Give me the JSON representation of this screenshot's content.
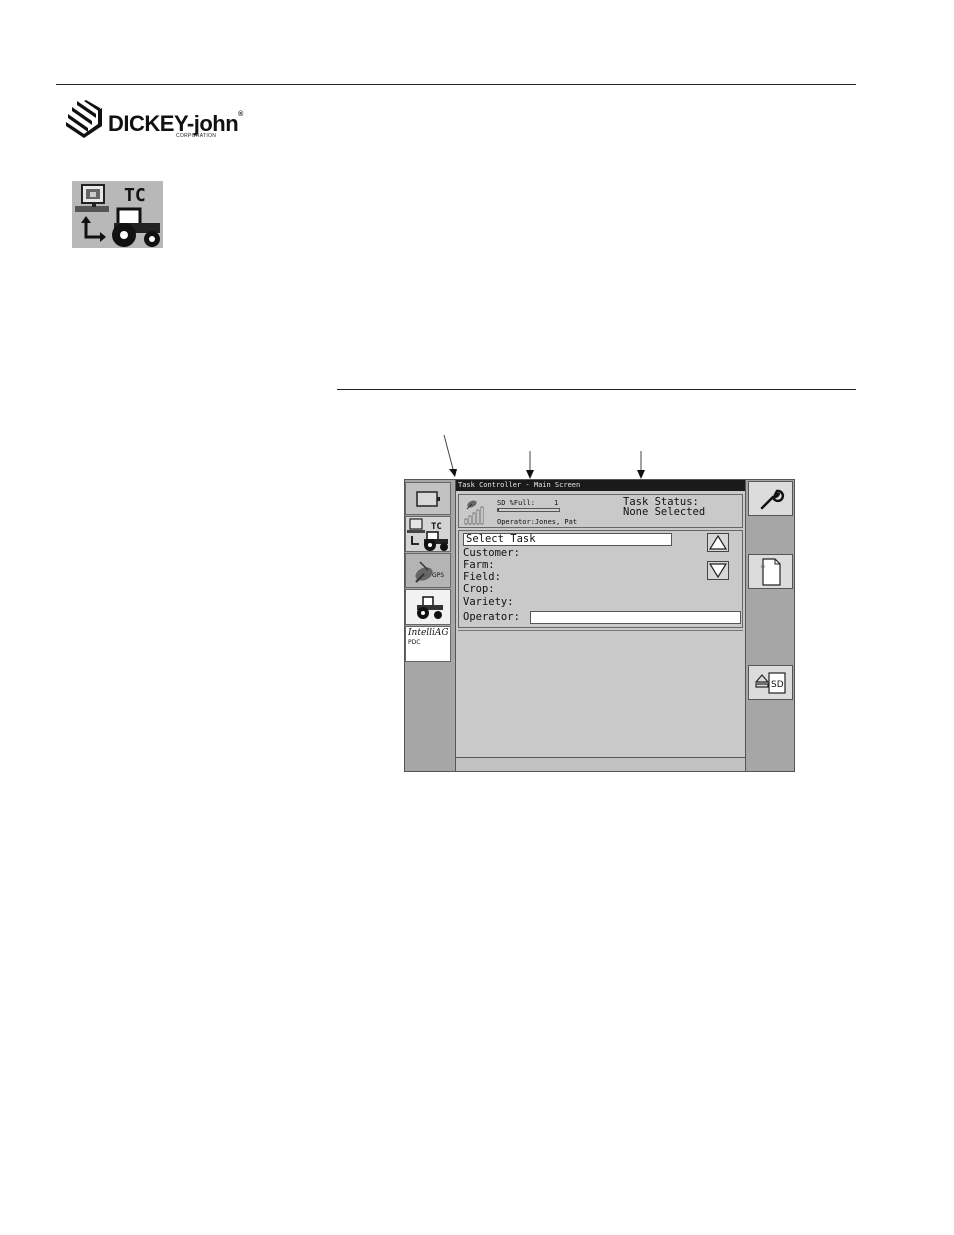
{
  "brand": {
    "name": "DICKEY-john",
    "registered": "®",
    "sub": "CORPORATION"
  },
  "tc_icon": {
    "label": "TC"
  },
  "screen": {
    "title": "Task Controller - Main Screen",
    "sd_label": "SD %Full:",
    "sd_value": "1",
    "sd_fill_fraction": 0.01,
    "operator_line": "Operator:Jones, Pat",
    "task_status_label": "Task Status:",
    "task_status_value": "None Selected",
    "select_task": "Select Task",
    "fields": [
      "Customer:",
      "Farm:",
      "Field:",
      "Crop:",
      "Variety:"
    ],
    "operator_label": "Operator:",
    "left_tabs": {
      "tc_label": "TC",
      "gps_label": "GPS",
      "intelliag_label": "IntelliAG",
      "pdc_label": "PDC"
    },
    "sd_button_label": "SD"
  },
  "colors": {
    "screen_bg": "#c9c9c9",
    "side_bg": "#a6a6a6",
    "titlebar": "#1a1a1a"
  }
}
